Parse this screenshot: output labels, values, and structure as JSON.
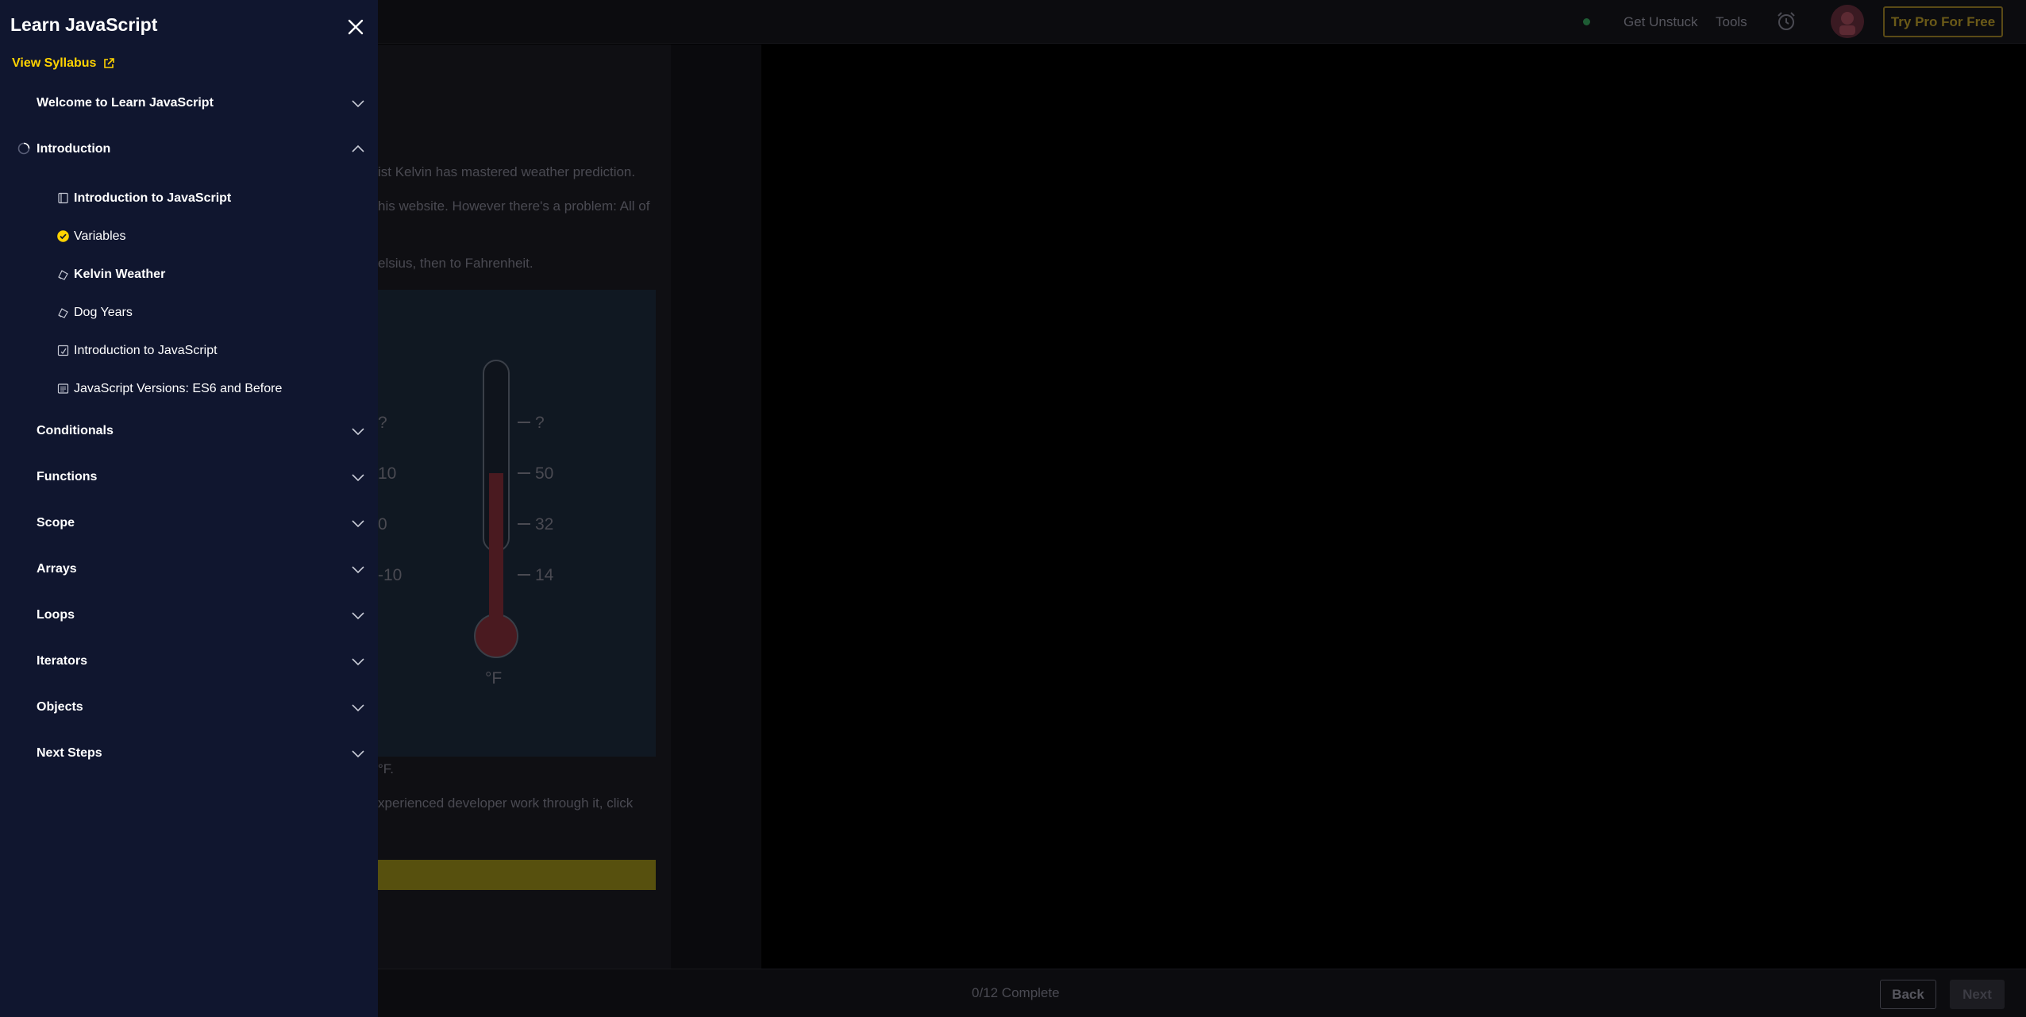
{
  "header": {
    "get_unstuck": "Get Unstuck",
    "tools": "Tools",
    "try_pro": "Try Pro For Free"
  },
  "lesson": {
    "line1": "ist Kelvin has mastered weather prediction.",
    "line2": "his website. However there's a problem: All of",
    "line3": "elsius, then to Fahrenheit.",
    "line4": "°F.",
    "line5": "xperienced developer work through it, click",
    "thermometer": {
      "left_ticks": [
        "?",
        "10",
        "0",
        "-10"
      ],
      "right_ticks": [
        "?",
        "50",
        "32",
        "14"
      ],
      "unit": "°F"
    }
  },
  "footer": {
    "progress": "0/12 Complete",
    "back": "Back",
    "next": "Next"
  },
  "drawer": {
    "title": "Learn JavaScript",
    "view_syllabus": "View Syllabus",
    "modules": [
      {
        "label": "Welcome to Learn JavaScript"
      },
      {
        "label": "Introduction"
      },
      {
        "label": "Conditionals"
      },
      {
        "label": "Functions"
      },
      {
        "label": "Scope"
      },
      {
        "label": "Arrays"
      },
      {
        "label": "Loops"
      },
      {
        "label": "Iterators"
      },
      {
        "label": "Objects"
      },
      {
        "label": "Next Steps"
      }
    ],
    "lessons": [
      {
        "label": "Introduction to JavaScript",
        "icon": "lesson-doc-icon",
        "status": "in-progress"
      },
      {
        "label": "Variables",
        "icon": "check-circle-icon",
        "status": "complete"
      },
      {
        "label": "Kelvin Weather",
        "icon": "project-icon",
        "status": "current"
      },
      {
        "label": "Dog Years",
        "icon": "project-icon",
        "status": "not-started"
      },
      {
        "label": "Introduction to JavaScript",
        "icon": "quiz-icon",
        "status": "not-started"
      },
      {
        "label": "JavaScript Versions: ES6 and Before",
        "icon": "article-icon",
        "status": "not-started"
      }
    ]
  },
  "colors": {
    "drawer_bg": "#10162f",
    "accent_yellow": "#ffd300",
    "check_yellow": "#ffd300"
  }
}
